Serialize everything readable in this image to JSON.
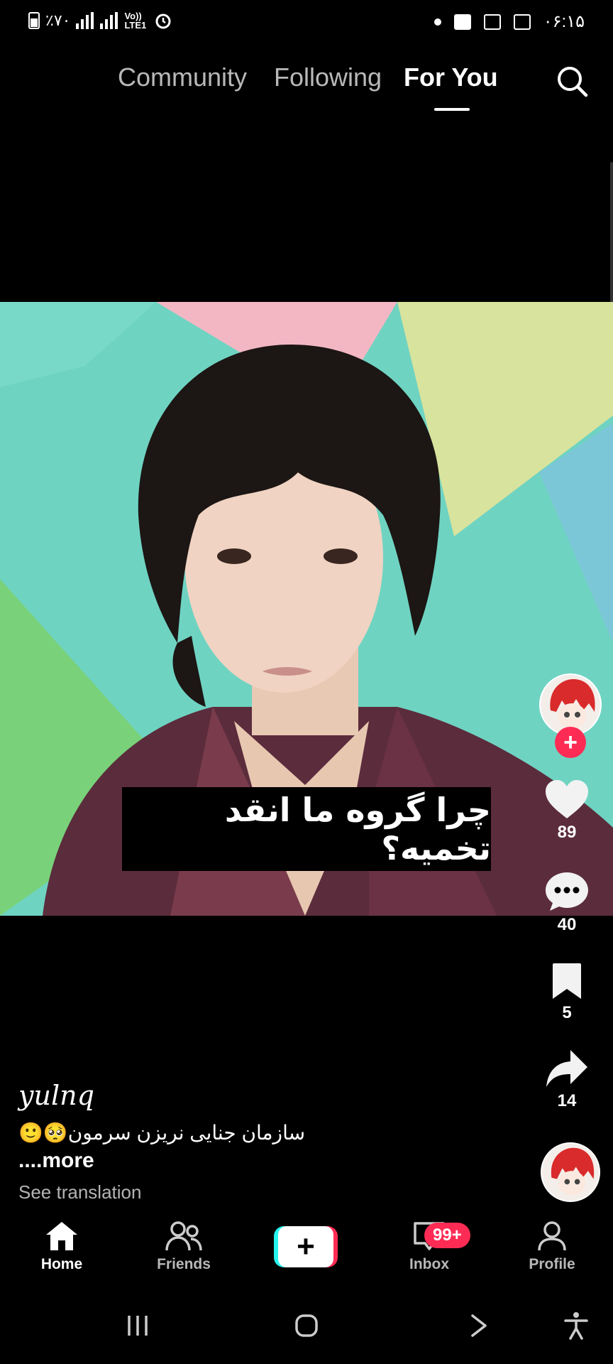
{
  "status_bar": {
    "battery": "٪۷۰",
    "network": "Vo)) LTE1",
    "time": "۰۶:۱۵"
  },
  "top_nav": {
    "tabs": [
      {
        "label": "Community"
      },
      {
        "label": "Following"
      },
      {
        "label": "For You"
      }
    ],
    "active_tab": "For You"
  },
  "video": {
    "caption_overlay": "چرا گروه ما انقد تخمیه؟"
  },
  "actions": {
    "likes": "89",
    "comments": "40",
    "saves": "5",
    "shares": "14"
  },
  "post": {
    "username": "yulnq",
    "description": "سازمان جنایی نریزن سرمون🥺🙂",
    "more_label": "....more",
    "see_translation_label": "See translation"
  },
  "bottom_nav": {
    "items": [
      {
        "label": "Home"
      },
      {
        "label": "Friends"
      },
      {
        "label": "Inbox"
      },
      {
        "label": "Profile"
      }
    ],
    "inbox_badge": "99+"
  },
  "colors": {
    "accent": "#fe2c55",
    "cyan": "#25f4ee",
    "background": "#000000"
  }
}
